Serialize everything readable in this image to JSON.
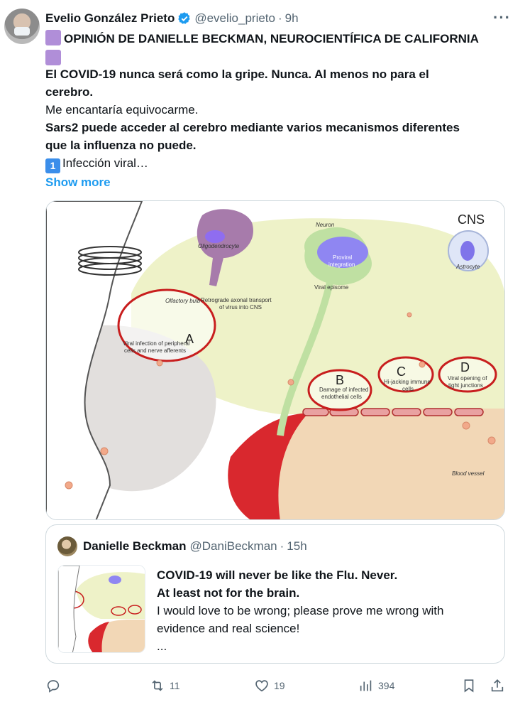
{
  "tweet": {
    "author_name": "Evelio González Prieto",
    "handle": "@evelio_prieto",
    "separator": "·",
    "time": "9h",
    "more_label": "···",
    "lines": [
      "OPINIÓN DE DANIELLE BECKMAN, NEUROCIENTÍFICA DE CALIFORNIA",
      "El COVID-19 nunca será como la gripe. Nunca. Al menos no para el",
      "cerebro.",
      "Me encantaría equivocarme.",
      "Sars2 puede acceder al cerebro mediante varios mecanismos diferentes",
      "que la influenza no puede.",
      "Infección viral…"
    ],
    "badge_one": "1",
    "show_more": "Show more"
  },
  "figure": {
    "labels": {
      "cns": "CNS",
      "neuron": "Neuron",
      "oligodendrocyte": "Oligodendrocyte",
      "proviral": "Proviral",
      "integration": "integration",
      "astrocyte": "Astrocyte",
      "viral_episome": "Viral episome",
      "retrograde_1": "Retrograde axonal transport",
      "retrograde_2": "of virus into CNS",
      "olfactory_bulb": "Olfactory bulb",
      "a_letter": "A",
      "a_text_1": "Viral infection of peripheral",
      "a_text_2": "cells and nerve afferents",
      "b_letter": "B",
      "b_text_1": "Damage of infected",
      "b_text_2": "endothelial cells",
      "c_letter": "C",
      "c_text_1": "Hi-jacking immune",
      "c_text_2": "cells",
      "d_letter": "D",
      "d_text_1": "Viral opening of",
      "d_text_2": "tight junctions",
      "blood_vessel": "Blood vessel"
    }
  },
  "quote": {
    "author_name": "Danielle Beckman",
    "handle": "@DaniBeckman",
    "separator": "·",
    "time": "15h",
    "line1": "COVID-19 will never be like the Flu. Never.",
    "line2": "At least not for the brain.",
    "line3": "I would love to be wrong; please prove me wrong with",
    "line4": "evidence and real science!",
    "line5": "..."
  },
  "actions": {
    "replies": "",
    "retweets": "11",
    "likes": "19",
    "views": "394"
  },
  "colors": {
    "link": "#1d9bf0",
    "muted": "#536471",
    "verified": "#1d9bf0",
    "red_circle": "#c81e1e",
    "cns_bg": "#eef2c8"
  }
}
